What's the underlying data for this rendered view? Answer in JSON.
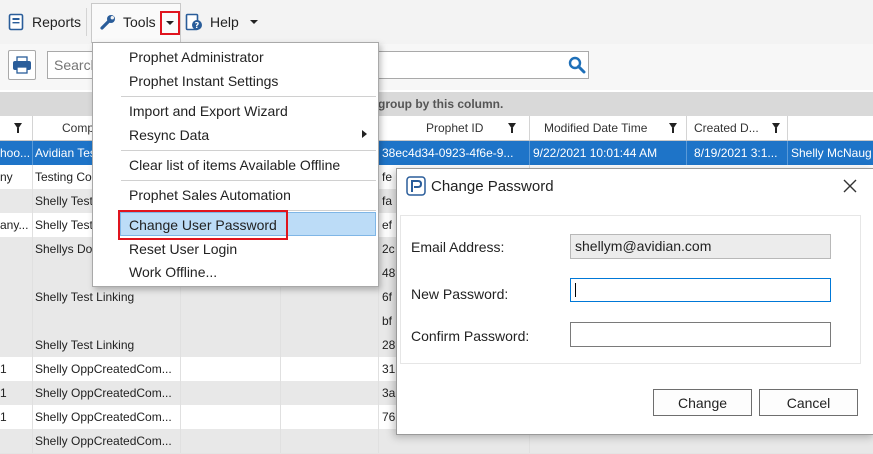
{
  "menubar": {
    "reports_label": "Reports",
    "tools_label": "Tools",
    "help_label": "Help"
  },
  "toolbar": {
    "search_placeholder": "Search"
  },
  "grid": {
    "group_hint": "group by this column.",
    "columns": {
      "company": "Comp",
      "prophet_id": "Prophet ID",
      "modified": "Modified Date Time",
      "created": "Created D..."
    },
    "selected_row": {
      "col0": "hoo...",
      "company": "Avidian Tes",
      "prophet_id": "38ec4d34-0923-4f6e-9...",
      "modified": "9/22/2021 10:01:44 AM",
      "created": "8/19/2021 3:1...",
      "owner": "Shelly McNaug"
    },
    "rows": [
      {
        "col0": "ny",
        "company": "Testing Co",
        "pid": "fe"
      },
      {
        "col0": "",
        "company": "Shelly Test",
        "pid": "fa"
      },
      {
        "col0": "any...",
        "company": "Shelly Test",
        "pid": "ef"
      },
      {
        "col0": "",
        "company": "Shellys Dog",
        "pid": "2c"
      },
      {
        "col0": "",
        "company": "",
        "pid": "48"
      },
      {
        "col0": "",
        "company": "Shelly Test Linking",
        "pid": "6f"
      },
      {
        "col0": "",
        "company": "",
        "pid": "bf"
      },
      {
        "col0": "",
        "company": "Shelly Test Linking",
        "pid": "28"
      },
      {
        "col0": "1",
        "company": "Shelly  OppCreatedCom...",
        "pid": "31"
      },
      {
        "col0": "1",
        "company": "Shelly  OppCreatedCom...",
        "pid": "3a"
      },
      {
        "col0": "1",
        "company": "Shelly  OppCreatedCom...",
        "pid": "76"
      },
      {
        "col0": "",
        "company": "Shelly  OppCreatedCom...",
        "pid": ""
      }
    ]
  },
  "tools_menu": {
    "items": [
      "Prophet Administrator",
      "Prophet Instant Settings",
      "Import and Export Wizard",
      "Resync Data",
      "Clear list of items Available Offline",
      "Prophet Sales Automation",
      "Change User Password",
      "Reset User Login",
      "Work Offline..."
    ]
  },
  "dialog": {
    "title": "Change Password",
    "email_label": "Email Address:",
    "email_value": "shellym@avidian.com",
    "new_password_label": "New Password:",
    "new_password_value": "",
    "confirm_password_label": "Confirm Password:",
    "confirm_password_value": "",
    "change_button": "Change",
    "cancel_button": "Cancel"
  },
  "colors": {
    "selection": "#1e74c8",
    "highlight_menu": "#bcdcf7",
    "red_outline": "#e0141e"
  }
}
